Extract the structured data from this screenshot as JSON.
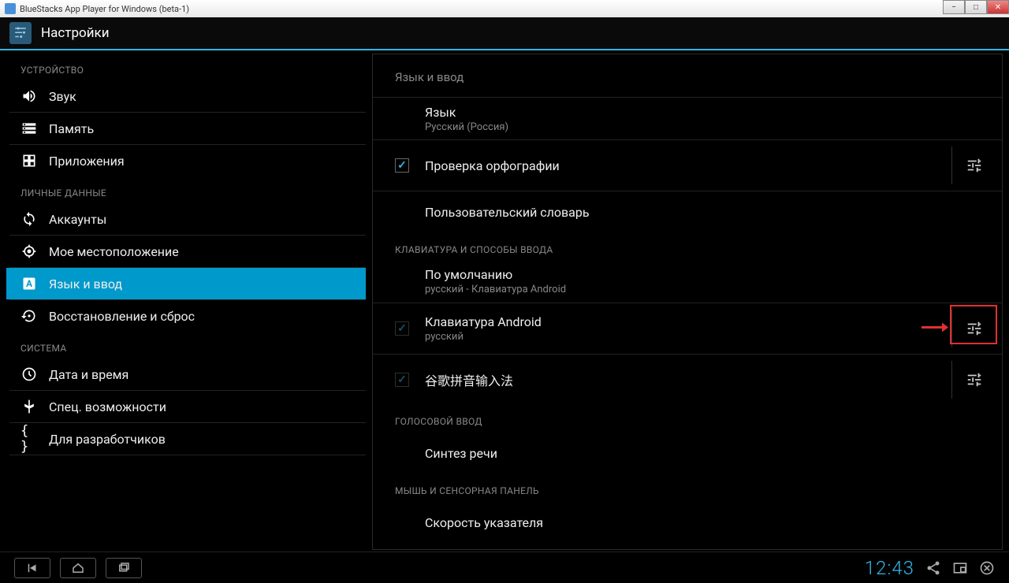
{
  "window": {
    "title": "BlueStacks App Player for Windows (beta-1)"
  },
  "header": {
    "title": "Настройки"
  },
  "sidebar": {
    "cat_device": "УСТРОЙСТВО",
    "cat_personal": "ЛИЧНЫЕ ДАННЫЕ",
    "cat_system": "СИСТЕМА",
    "sound": "Звук",
    "memory": "Память",
    "apps": "Приложения",
    "accounts": "Аккаунты",
    "location": "Мое местоположение",
    "lang_input": "Язык и ввод",
    "backup": "Восстановление и сброс",
    "datetime": "Дата и время",
    "a11y": "Спец. возможности",
    "dev": "Для разработчиков"
  },
  "main": {
    "header": "Язык и ввод",
    "lang_title": "Язык",
    "lang_sub": "Русский (Россия)",
    "spell": "Проверка орфографии",
    "dict": "Пользовательский словарь",
    "sect_kb": "КЛАВИАТУРА И СПОСОБЫ ВВОДА",
    "default_title": "По умолчанию",
    "default_sub": "русский - Клавиатура Android",
    "androidkb_title": "Клавиатура Android",
    "androidkb_sub": "русский",
    "pinyin": "谷歌拼音输入法",
    "sect_voice": "ГОЛОСОВОЙ ВВОД",
    "tts": "Синтез речи",
    "sect_mouse": "МЫШЬ И СЕНСОРНАЯ ПАНЕЛЬ",
    "pointer": "Скорость указателя"
  },
  "navbar": {
    "time": "12:43"
  }
}
